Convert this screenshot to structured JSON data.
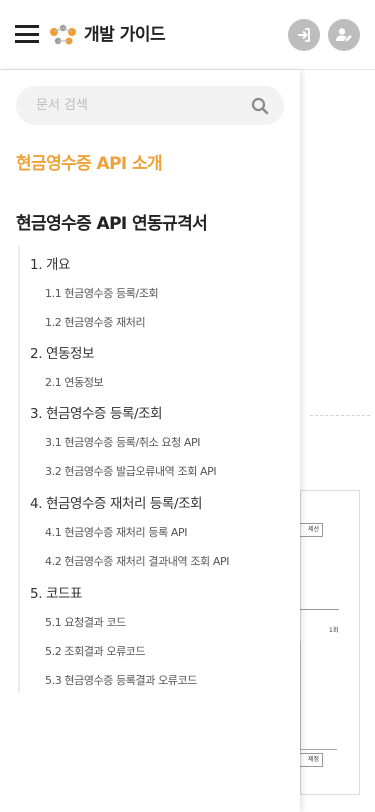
{
  "header": {
    "site_title": "개발 가이드",
    "menu_icon": "hamburger-menu-icon",
    "logo_icon": "logo-icon",
    "login_icon": "login-icon",
    "signup_icon": "user-edit-icon"
  },
  "search": {
    "placeholder": "문서 검색",
    "value": ""
  },
  "nav": {
    "intro_label": "현금영수증 API 소개",
    "spec_title": "현금영수증 API 연동규격서",
    "toc": [
      {
        "label": "1. 개요",
        "level": 1
      },
      {
        "label": "1.1 현금영수증 등록/조회",
        "level": 2
      },
      {
        "label": "1.2 현금영수증 재처리",
        "level": 2
      },
      {
        "label": "2. 연동정보",
        "level": 1
      },
      {
        "label": "2.1 연동정보",
        "level": 2
      },
      {
        "label": "3. 현금영수증 등록/조회",
        "level": 1
      },
      {
        "label": "3.1 현금영수증 등록/취소 요청 API",
        "level": 2
      },
      {
        "label": "3.2 현금영수증 발급오류내역 조회 API",
        "level": 2
      },
      {
        "label": "4. 현금영수증 재처리 등록/조회",
        "level": 1
      },
      {
        "label": "4.1 현금영수증 재처리 등록 API",
        "level": 2
      },
      {
        "label": "4.2 현금영수증 재처리 결과내역 조회 API",
        "level": 2
      },
      {
        "label": "5. 코드표",
        "level": 1
      },
      {
        "label": "5.1 요청결과 코드",
        "level": 2
      },
      {
        "label": "5.2 조회결과 오류코드",
        "level": 2
      },
      {
        "label": "5.3 현금영수증 등록결과 오류코드",
        "level": 2
      }
    ]
  },
  "background": {
    "box1_label": "제선",
    "box2_label": "제정",
    "note": "1회"
  },
  "colors": {
    "accent": "#f0a23a",
    "logo_orange": "#f39c33",
    "logo_gray": "#9e9e9e",
    "header_button": "#bdbdbd"
  }
}
